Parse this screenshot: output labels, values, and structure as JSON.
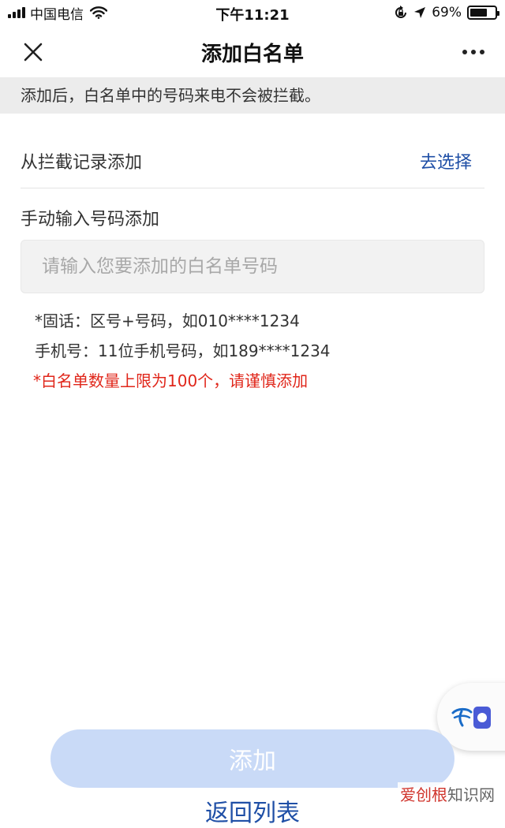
{
  "status_bar": {
    "carrier": "中国电信",
    "time": "下午11:21",
    "battery_percent": "69%",
    "battery_level": 0.69
  },
  "nav": {
    "title": "添加白名单",
    "close_icon": "close-icon",
    "more_icon": "more-horizontal-icon"
  },
  "notice": "添加后，白名单中的号码来电不会被拦截。",
  "from_records": {
    "label": "从拦截记录添加",
    "action": "去选择"
  },
  "manual": {
    "label": "手动输入号码添加",
    "placeholder": "请输入您要添加的白名单号码",
    "value": ""
  },
  "hints": {
    "landline": "*固话：区号+号码，如010****1234",
    "mobile": "手机号：11位手机号码，如189****1234",
    "limit_warning": "*白名单数量上限为100个，请谨慎添加"
  },
  "add_button": "添加",
  "back_link": "返回列表",
  "watermark": {
    "brand": "爱创根",
    "suffix": "知识网"
  },
  "colors": {
    "link": "#1f4fa6",
    "warning": "#e0261a",
    "button_disabled": "#c9daf7",
    "notice_bg": "#ececec"
  }
}
